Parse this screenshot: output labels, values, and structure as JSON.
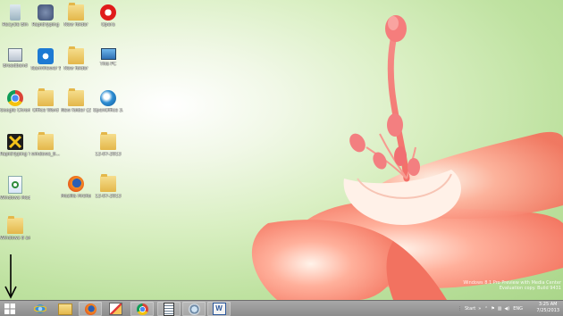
{
  "desktop": {
    "icons": [
      {
        "label": "Recycle Bin",
        "icon": "recycle-bin-icon"
      },
      {
        "label": "RapidTyping",
        "icon": "rapidtyping-icon"
      },
      {
        "label": "New folder",
        "icon": "folder-icon"
      },
      {
        "label": "Opera",
        "icon": "opera-icon"
      },
      {
        "label": "Broadband",
        "icon": "broadband-icon"
      },
      {
        "label": "TeamViewer 9",
        "icon": "teamviewer-icon"
      },
      {
        "label": "New folder",
        "icon": "folder-icon"
      },
      {
        "label": "This PC",
        "icon": "computer-icon"
      },
      {
        "label": "Google Chrome",
        "icon": "chrome-icon"
      },
      {
        "label": "Office Word",
        "icon": "word-file-icon"
      },
      {
        "label": "New folder (2)",
        "icon": "folder-icon"
      },
      {
        "label": "OpenOffice 3.4.0",
        "icon": "openoffice-icon"
      },
      {
        "label": "RapidTyping Tutor",
        "icon": "rapidtyping-tutor-icon"
      },
      {
        "label": "windows_8...",
        "icon": "folder-icon"
      },
      {
        "label": "12-07-2013",
        "icon": "folder-icon"
      },
      {
        "label": "Windows Media Cent...",
        "icon": "media-center-icon"
      },
      {
        "label": "Mozilla Firefox",
        "icon": "firefox-icon"
      },
      {
        "label": "12-07-2013",
        "icon": "folder-icon"
      },
      {
        "label": "Windows 8 and wallp...",
        "icon": "folder-icon"
      }
    ],
    "watermark": {
      "line1": "Windows 8.1 Pro Preview with Media Center",
      "line2": "Evaluation copy. Build 9431"
    }
  },
  "taskbar": {
    "start_label": "Start",
    "apps": [
      {
        "name": "Internet Explorer",
        "icon": "ie-icon"
      },
      {
        "name": "File Explorer",
        "icon": "file-explorer-icon"
      },
      {
        "name": "Firefox",
        "icon": "firefox-icon"
      },
      {
        "name": "Paint",
        "icon": "paint-icon"
      },
      {
        "name": "Google Chrome",
        "icon": "chrome-icon"
      },
      {
        "name": "Document",
        "icon": "document-icon"
      },
      {
        "name": "Network",
        "icon": "network-icon"
      },
      {
        "name": "Microsoft Word",
        "icon": "word-icon"
      }
    ],
    "tray": {
      "toolbar_label": "Start",
      "language": "ENG",
      "time": "3:25 AM",
      "date": "7/25/2013"
    }
  }
}
